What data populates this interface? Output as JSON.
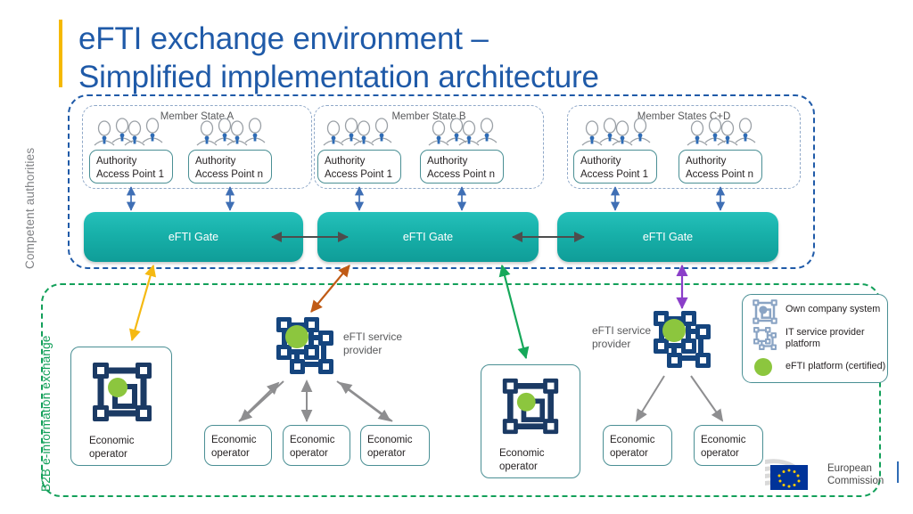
{
  "title": {
    "line1": "eFTI exchange environment –",
    "line2": "Simplified implementation architecture",
    "color": "#1f5aa8",
    "accent_bar_color": "#f5b900"
  },
  "regions": {
    "top": {
      "label": "Competent authorities",
      "border_color": "#1f5aa8",
      "label_color": "#808285"
    },
    "bottom": {
      "label": "B2B e-information exchange",
      "border_color": "#13a05a",
      "label_color": "#13a05a"
    }
  },
  "member_states": [
    {
      "name": "Member State A",
      "access_points": [
        {
          "line1": "Authority",
          "line2": "Access Point 1"
        },
        {
          "line1": "Authority",
          "line2": "Access Point n"
        }
      ]
    },
    {
      "name": "Member State B",
      "access_points": [
        {
          "line1": "Authority",
          "line2": "Access Point 1"
        },
        {
          "line1": "Authority",
          "line2": "Access Point n"
        }
      ]
    },
    {
      "name": "Member States C+D",
      "access_points": [
        {
          "line1": "Authority",
          "line2": "Access Point 1"
        },
        {
          "line1": "Authority",
          "line2": "Access Point n"
        }
      ]
    }
  ],
  "gates": [
    {
      "label": "eFTI Gate"
    },
    {
      "label": "eFTI Gate"
    },
    {
      "label": "eFTI Gate"
    }
  ],
  "gate_style": {
    "fill_top": "#25c0ba",
    "fill_bottom": "#0f9d98",
    "text_color": "#ffffff"
  },
  "b2b": {
    "company_systems": [
      {
        "line1": "Economic",
        "line2": "operator",
        "icon": "own-company-system-icon"
      },
      {
        "line1": "Economic",
        "line2": "operator",
        "icon": "own-company-system-icon"
      }
    ],
    "service_providers": [
      {
        "line1": "eFTI service",
        "line2": "provider",
        "icon": "it-service-provider-icon"
      },
      {
        "line1": "eFTI service",
        "line2": "provider",
        "icon": "it-service-provider-icon"
      }
    ],
    "operators_left": [
      {
        "line1": "Economic",
        "line2": "operator"
      },
      {
        "line1": "Economic",
        "line2": "operator"
      },
      {
        "line1": "Economic",
        "line2": "operator"
      }
    ],
    "operators_right": [
      {
        "line1": "Economic",
        "line2": "operator"
      },
      {
        "line1": "Economic",
        "line2": "operator"
      }
    ]
  },
  "legend": {
    "items": [
      {
        "label_line1": "Own company system",
        "label_line2": "",
        "icon": "own-company-system-icon"
      },
      {
        "label_line1": "IT service provider",
        "label_line2": "platform",
        "icon": "it-service-provider-icon"
      },
      {
        "label_line1": "eFTI platform (certified)",
        "label_line2": "",
        "icon": "green-dot-icon"
      }
    ],
    "green_dot_color": "#8cc63e"
  },
  "connector_colors": {
    "authority_to_gate": "#3f6fb5",
    "gate_to_gate": "#4d4d4d",
    "gate_a_to_operator": "#f5b912",
    "gate_b_to_provider": "#c05b16",
    "gate_b_to_operator": "#16a85a",
    "gate_c_to_provider": "#8b3fc9",
    "operator_to_provider": "#808285"
  },
  "footer": {
    "org_line1": "European",
    "org_line2": "Commission",
    "flag_color": "#003399",
    "star_color": "#ffcc00"
  }
}
